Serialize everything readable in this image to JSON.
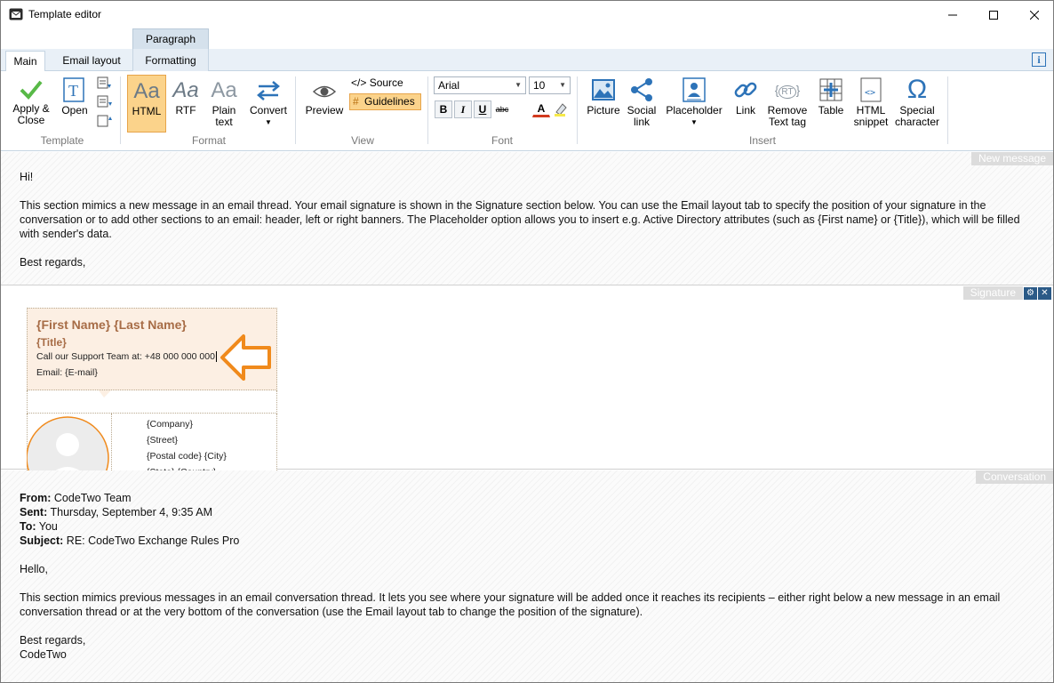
{
  "window": {
    "title": "Template editor"
  },
  "tabs": {
    "context_group": "Paragraph",
    "items": [
      "Main",
      "Email layout",
      "Formatting"
    ],
    "info_label": "i"
  },
  "ribbon": {
    "template": {
      "apply_close": "Apply &",
      "apply_close_2": "Close",
      "open": "Open",
      "group": "Template"
    },
    "format": {
      "html": "HTML",
      "rtf": "RTF",
      "plain": "Plain",
      "plain_2": "text",
      "convert": "Convert",
      "group": "Format",
      "aa": "Aa"
    },
    "view": {
      "preview": "Preview",
      "source": "Source",
      "source_prefix": "</>",
      "guidelines": "Guidelines",
      "group": "View"
    },
    "font": {
      "family": "Arial",
      "size": "10",
      "bold": "B",
      "italic": "I",
      "underline": "U",
      "strike": "abc",
      "color": "A",
      "group": "Font"
    },
    "insert": {
      "picture": "Picture",
      "social": "Social",
      "social_2": "link",
      "placeholder": "Placeholder",
      "link": "Link",
      "remove": "Remove",
      "remove_2": "Text tag",
      "table": "Table",
      "html_snippet": "HTML",
      "html_snippet_2": "snippet",
      "special": "Special",
      "special_2": "character",
      "group": "Insert",
      "rt": "RT",
      "omega": "Ω"
    }
  },
  "new_message": {
    "tag": "New message",
    "greeting": "Hi!",
    "body": "This section mimics a new message in an email thread. Your email signature is shown in the Signature section below. You can use the Email layout tab to specify the position of your signature in the conversation or to add other sections to an email: header, left or right banners. The Placeholder option allows you to insert e.g. Active Directory attributes (such as {First name} or {Title}), which will be filled with sender's data.",
    "closing": "Best regards,"
  },
  "signature": {
    "tag": "Signature",
    "name": "{First Name} {Last Name}",
    "title": "{Title}",
    "support_line": "Call our Support Team at: +48 000 000 000",
    "email_line": "Email: {E-mail}",
    "company": "{Company}",
    "street": "{Street}",
    "postal": "{Postal code} {City}",
    "state": "{State} {Country}"
  },
  "conversation": {
    "tag": "Conversation",
    "from_label": "From:",
    "from_value": " CodeTwo Team",
    "sent_label": "Sent:",
    "sent_value": " Thursday, September 4, 9:35 AM",
    "to_label": "To:",
    "to_value": " You",
    "subject_label": "Subject:",
    "subject_value": " RE: CodeTwo Exchange Rules Pro",
    "hello": "Hello,",
    "body": "This section mimics previous messages in an email conversation thread. It lets you see where your signature will be added once it reaches its recipients – either right below a new message in an email conversation thread or at the very bottom of the conversation (use the Email layout tab to change the position of the signature).",
    "closing": "Best regards,",
    "signoff": "CodeTwo"
  },
  "colors": {
    "accent": "#2d73b8",
    "signature_brand": "#a76c46",
    "arrow": "#f08a1c",
    "active_button": "#fbd38b"
  }
}
